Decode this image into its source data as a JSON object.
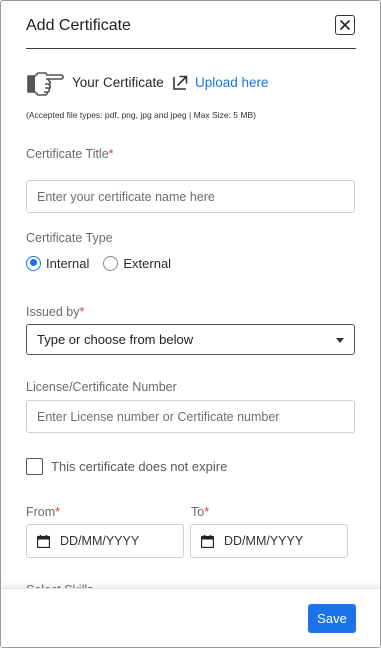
{
  "header": {
    "title": "Add Certificate",
    "close_icon": "close-icon"
  },
  "upload": {
    "hand_icon": "pointing-hand-icon",
    "your_certificate": "Your Certificate",
    "upload_icon": "external-link-arrow-icon",
    "upload_link": "Upload here",
    "accepted_types": "(Accepted file types: pdf, png, jpg and jpeg | Max Size: 5 MB)"
  },
  "certificate_title": {
    "label": "Certificate Title",
    "required_mark": "*",
    "placeholder": "Enter your certificate name here"
  },
  "certificate_type": {
    "label": "Certificate Type",
    "options": [
      "Internal",
      "External"
    ],
    "selected": "Internal"
  },
  "issued_by": {
    "label": "Issued by",
    "required_mark": "*",
    "value": "Type or choose from below"
  },
  "license_number": {
    "label": "License/Certificate Number",
    "placeholder": "Enter License number or Certificate number"
  },
  "no_expire": {
    "label": "This certificate does not expire",
    "checked": false
  },
  "dates": {
    "from_label": "From",
    "from_required": "*",
    "from_value": "DD/MM/YYYY",
    "to_label": "To",
    "to_required": "*",
    "to_value": "DD/MM/YYYY",
    "calendar_icon": "calendar-icon"
  },
  "partial_section": {
    "label": "Select Skills"
  },
  "footer": {
    "save_label": "Save"
  },
  "colors": {
    "accent": "#1a73e8",
    "required": "#e0393e",
    "border": "#cfcfcf"
  }
}
